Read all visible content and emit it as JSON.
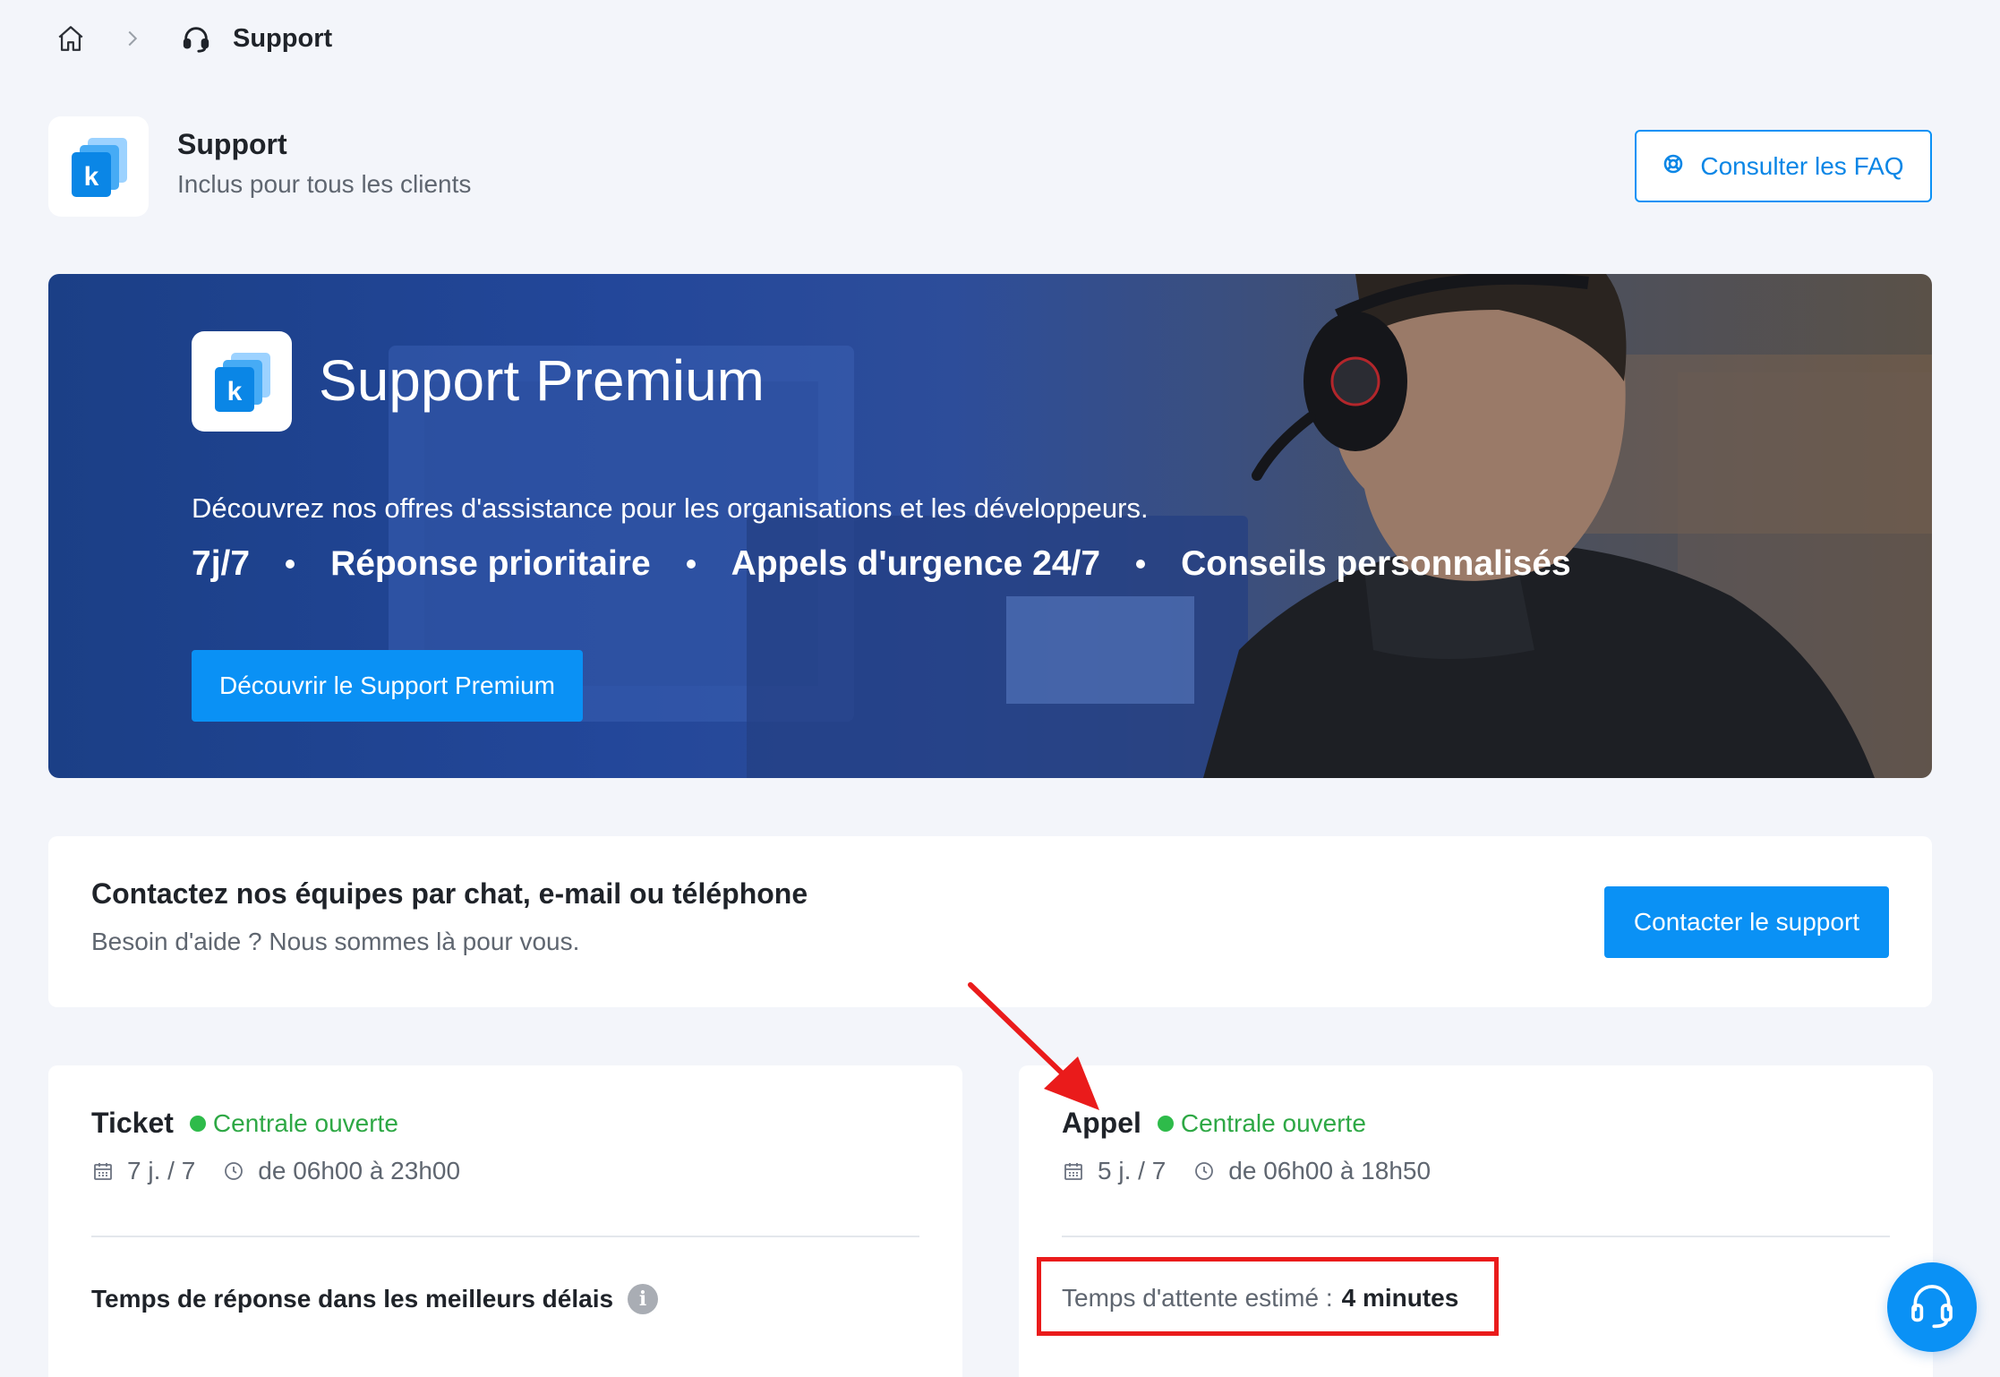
{
  "breadcrumb": {
    "current": "Support"
  },
  "header": {
    "title": "Support",
    "subtitle": "Inclus pour tous les clients",
    "faq_button": "Consulter les FAQ",
    "logo_letter": "k"
  },
  "banner": {
    "title": "Support Premium",
    "description": "Découvrez nos offres d'assistance pour les organisations et les développeurs.",
    "features": [
      "7j/7",
      "Réponse prioritaire",
      "Appels d'urgence 24/7",
      "Conseils personnalisés"
    ],
    "cta": "Découvrir le Support Premium"
  },
  "contact": {
    "title": "Contactez nos équipes par chat, e-mail ou téléphone",
    "subtitle": "Besoin d'aide ? Nous sommes là pour vous.",
    "button": "Contacter le support"
  },
  "channels": {
    "ticket": {
      "name": "Ticket",
      "status": "Centrale ouverte",
      "days": "7 j. / 7",
      "hours": "de 06h00 à 23h00",
      "note": "Temps de réponse dans les meilleurs délais"
    },
    "call": {
      "name": "Appel",
      "status": "Centrale ouverte",
      "days": "5 j. / 7",
      "hours": "de 06h00 à 18h50",
      "wait_label": "Temps d'attente estimé :",
      "wait_value": "4 minutes"
    }
  },
  "colors": {
    "accent": "#0a91f5",
    "status_green": "#2ebb4a",
    "annotation_red": "#ea1b1b"
  },
  "icons": {
    "home": "home-icon",
    "chevron": "chevron-right-icon",
    "headset": "headset-icon",
    "lifebuoy": "lifebuoy-icon",
    "calendar": "calendar-icon",
    "clock": "clock-icon",
    "info": "info-icon"
  }
}
